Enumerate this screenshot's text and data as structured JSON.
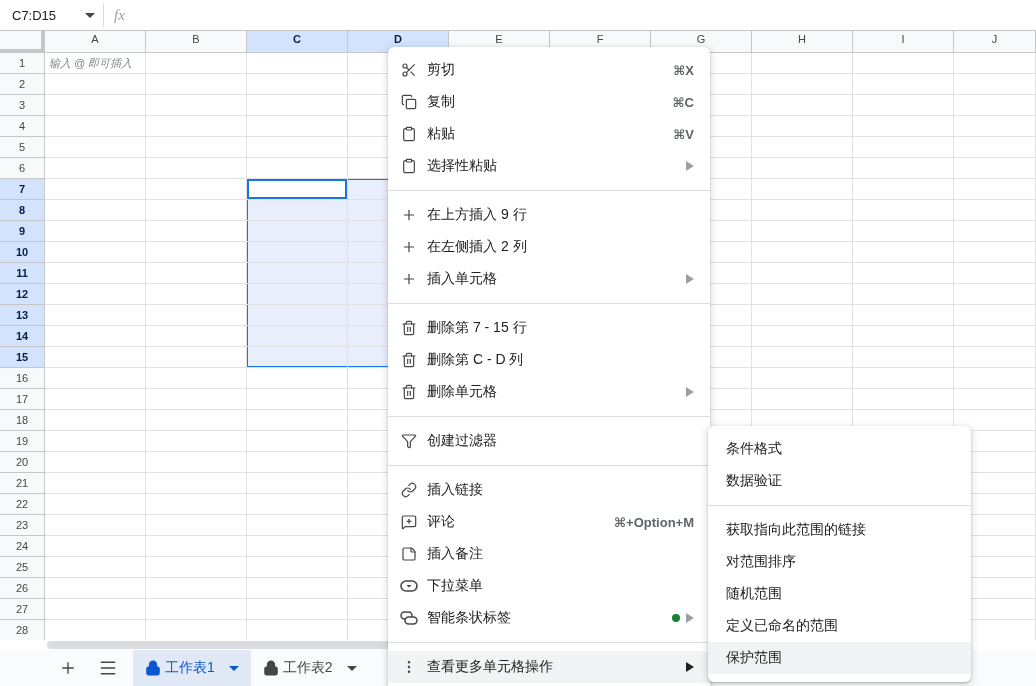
{
  "name_box": {
    "value": "C7:D15"
  },
  "formula_bar": {
    "label": "fx"
  },
  "columns": [
    {
      "label": "A",
      "selected": false
    },
    {
      "label": "B",
      "selected": false
    },
    {
      "label": "C",
      "selected": true
    },
    {
      "label": "D",
      "selected": true
    },
    {
      "label": "E",
      "selected": false
    },
    {
      "label": "F",
      "selected": false
    },
    {
      "label": "G",
      "selected": false
    },
    {
      "label": "H",
      "selected": false
    },
    {
      "label": "I",
      "selected": false
    },
    {
      "label": "J",
      "selected": false
    }
  ],
  "cell_hint": {
    "placeholder": "输入 @ 即可插入"
  },
  "rows": [
    {
      "label": "1",
      "selected": false
    },
    {
      "label": "2",
      "selected": false
    },
    {
      "label": "3",
      "selected": false
    },
    {
      "label": "4",
      "selected": false
    },
    {
      "label": "5",
      "selected": false
    },
    {
      "label": "6",
      "selected": false
    },
    {
      "label": "7",
      "selected": true
    },
    {
      "label": "8",
      "selected": true
    },
    {
      "label": "9",
      "selected": true
    },
    {
      "label": "10",
      "selected": true
    },
    {
      "label": "11",
      "selected": true
    },
    {
      "label": "12",
      "selected": true
    },
    {
      "label": "13",
      "selected": true
    },
    {
      "label": "14",
      "selected": true
    },
    {
      "label": "15",
      "selected": true
    },
    {
      "label": "16",
      "selected": false
    },
    {
      "label": "17",
      "selected": false
    },
    {
      "label": "18",
      "selected": false
    },
    {
      "label": "19",
      "selected": false
    },
    {
      "label": "20",
      "selected": false
    },
    {
      "label": "21",
      "selected": false
    },
    {
      "label": "22",
      "selected": false
    },
    {
      "label": "23",
      "selected": false
    },
    {
      "label": "24",
      "selected": false
    },
    {
      "label": "25",
      "selected": false
    },
    {
      "label": "26",
      "selected": false
    },
    {
      "label": "27",
      "selected": false
    },
    {
      "label": "28",
      "selected": false
    }
  ],
  "context_menu": {
    "sections": [
      [
        {
          "kind": "cut",
          "label": "剪切",
          "shortcut": "⌘X",
          "submenu": false,
          "selected": false
        },
        {
          "kind": "copy",
          "label": "复制",
          "shortcut": "⌘C",
          "submenu": false,
          "selected": false
        },
        {
          "kind": "paste",
          "label": "粘贴",
          "shortcut": "⌘V",
          "submenu": false,
          "selected": false
        },
        {
          "kind": "paste",
          "label": "选择性粘贴",
          "submenu": true,
          "selected": false
        }
      ],
      [
        {
          "kind": "insert",
          "label": "在上方插入 9 行",
          "submenu": false,
          "selected": false
        },
        {
          "kind": "insert",
          "label": "在左侧插入 2 列",
          "submenu": false,
          "selected": false
        },
        {
          "kind": "insert",
          "label": "插入单元格",
          "submenu": true,
          "selected": false
        }
      ],
      [
        {
          "kind": "delete",
          "label": "删除第 7 - 15 行",
          "submenu": false,
          "selected": false
        },
        {
          "kind": "delete",
          "label": "删除第 C - D 列",
          "submenu": false,
          "selected": false
        },
        {
          "kind": "delete",
          "label": "删除单元格",
          "submenu": true,
          "selected": false
        }
      ],
      [
        {
          "kind": "filter",
          "label": "创建过滤器",
          "submenu": false,
          "selected": false
        }
      ],
      [
        {
          "kind": "link",
          "label": "插入链接",
          "submenu": false,
          "selected": false
        },
        {
          "kind": "comment",
          "label": "评论",
          "shortcut": "⌘+Option+M",
          "submenu": false,
          "selected": false
        },
        {
          "kind": "note",
          "label": "插入备注",
          "submenu": false,
          "selected": false
        },
        {
          "kind": "dropdown",
          "label": "下拉菜单",
          "submenu": false,
          "selected": false
        },
        {
          "kind": "chip",
          "label": "智能条状标签",
          "submenu": true,
          "selected": false,
          "color": "#188038"
        }
      ],
      [
        {
          "kind": "more",
          "label": "查看更多单元格操作",
          "submenu": true,
          "selected": true
        }
      ]
    ]
  },
  "submenu": {
    "sections": [
      [
        {
          "label": "条件格式",
          "selected": false
        },
        {
          "label": "数据验证",
          "selected": false
        }
      ],
      [
        {
          "label": "获取指向此范围的链接",
          "selected": false
        },
        {
          "label": "对范围排序",
          "selected": false
        },
        {
          "label": "随机范围",
          "selected": false
        },
        {
          "label": "定义已命名的范围",
          "selected": false
        },
        {
          "label": "保护范围",
          "selected": true
        }
      ]
    ]
  },
  "sheet_tabs": [
    {
      "label": "工作表1",
      "selected": true,
      "locked": true
    },
    {
      "label": "工作表2",
      "selected": false,
      "locked": true
    }
  ]
}
